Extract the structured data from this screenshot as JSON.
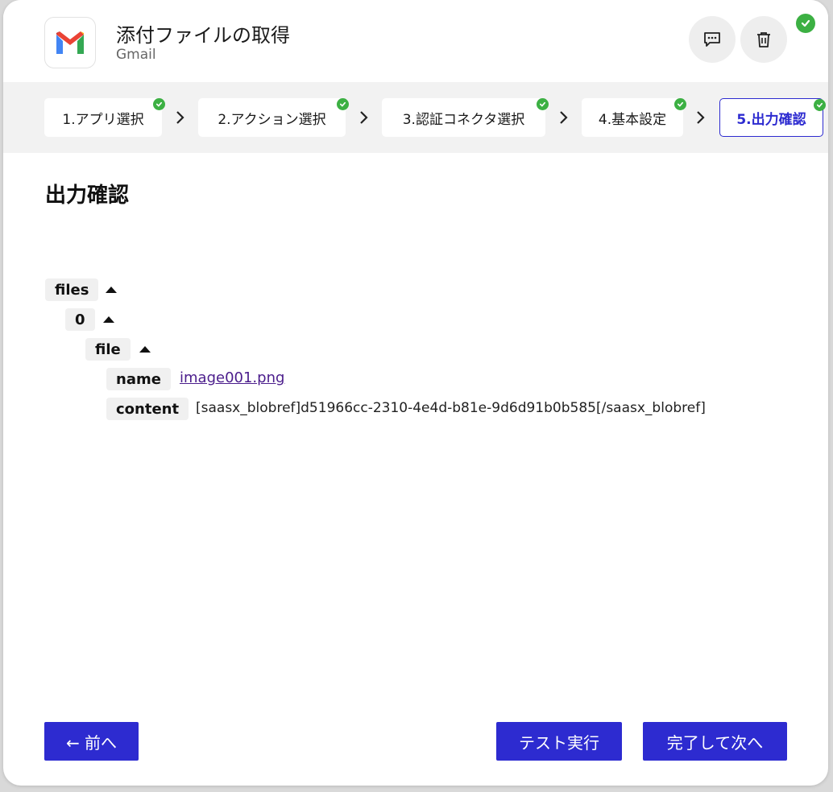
{
  "header": {
    "title": "添付ファイルの取得",
    "subtitle": "Gmail",
    "app_icon": "gmail-logo",
    "comment_icon": "comment-icon",
    "delete_icon": "trash-icon"
  },
  "steps": [
    {
      "label": "1.アプリ選択",
      "done": true
    },
    {
      "label": "2.アクション選択",
      "done": true
    },
    {
      "label": "3.認証コネクタ選択",
      "done": true
    },
    {
      "label": "4.基本設定",
      "done": true
    },
    {
      "label": "5.出力確認",
      "done": true,
      "active": true
    }
  ],
  "main": {
    "section_title": "出力確認"
  },
  "output_tree": {
    "files_key": "files",
    "index_key": "0",
    "file_key": "file",
    "name_key": "name",
    "name_value": "image001.png",
    "content_key": "content",
    "content_value": "[saasx_blobref]d51966cc-2310-4e4d-b81e-9d6d91b0b585[/saasx_blobref]"
  },
  "footer": {
    "back_label": "← 前へ",
    "test_label": "テスト実行",
    "next_label": "完了して次へ"
  },
  "colors": {
    "accent": "#2d2bd0",
    "success": "#3cb043",
    "link": "#4b1d8c"
  }
}
